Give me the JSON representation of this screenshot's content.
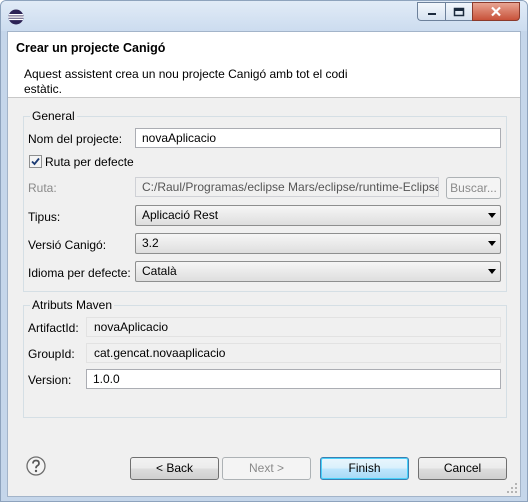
{
  "header": {
    "title": "Crear un projecte Canigó",
    "description": "Aquest assistent crea un nou projecte Canigó amb tot el codi estàtic."
  },
  "general": {
    "legend": "General",
    "project_name_label": "Nom del projecte:",
    "project_name_value": "novaAplicacio",
    "default_path_label": "Ruta per defecte",
    "default_path_checked": true,
    "path_label": "Ruta:",
    "path_value": "C:/Raul/Programas/eclipse Mars/eclipse/runtime-Eclipse",
    "browse_label": "Buscar...",
    "type_label": "Tipus:",
    "type_value": "Aplicació Rest",
    "version_label": "Versió Canigó:",
    "version_value": "3.2",
    "language_label": "Idioma per defecte:",
    "language_value": "Català"
  },
  "maven": {
    "legend": "Atributs Maven",
    "artifact_label": "ArtifactId:",
    "artifact_value": "novaAplicacio",
    "group_label": "GroupId:",
    "group_value": "cat.gencat.novaaplicacio",
    "version_label": "Version:",
    "version_value": "1.0.0"
  },
  "buttons": {
    "back": "< Back",
    "next": "Next >",
    "finish": "Finish",
    "cancel": "Cancel"
  },
  "icons": {
    "app": "eclipse-icon",
    "help": "help-icon",
    "minimize": "minimize-icon",
    "maximize": "maximize-icon",
    "close": "close-icon"
  },
  "colors": {
    "frame": "#c5d6ea",
    "close_button": "#c8523a",
    "default_button_border": "#3c7fb1"
  }
}
